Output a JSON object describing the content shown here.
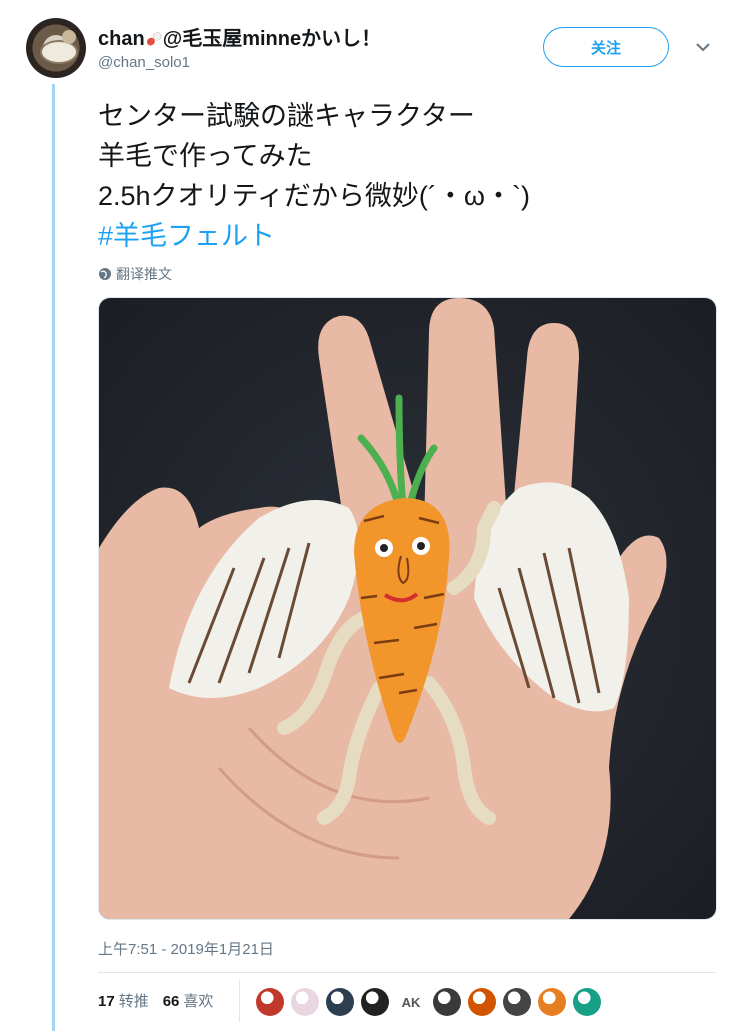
{
  "author": {
    "display_name": "chan",
    "display_name_suffix": "@毛玉屋minneかいし！",
    "handle": "@chan_solo1"
  },
  "follow_button": {
    "label": "关注"
  },
  "tweet": {
    "lines": [
      "センター試験の謎キャラクター",
      "羊毛で作ってみた",
      "2.5hクオリティだから微妙(´・ω・`)"
    ],
    "hashtag": "#羊毛フェルト",
    "translate_label": "翻译推文",
    "timestamp": "上午7:51 - 2019年1月21日"
  },
  "stats": {
    "retweets_count": "17",
    "retweets_label": "转推",
    "likes_count": "66",
    "likes_label": "喜欢"
  },
  "likers": [
    {
      "kind": "avatar",
      "color": "#c0392b"
    },
    {
      "kind": "avatar",
      "color": "#e8d7e0"
    },
    {
      "kind": "avatar",
      "color": "#2c3e50"
    },
    {
      "kind": "avatar",
      "color": "#222222"
    },
    {
      "kind": "text",
      "text": "AK"
    },
    {
      "kind": "avatar",
      "color": "#3a3a3a"
    },
    {
      "kind": "avatar",
      "color": "#d35400"
    },
    {
      "kind": "avatar",
      "color": "#444444"
    },
    {
      "kind": "avatar",
      "color": "#e67e22"
    },
    {
      "kind": "avatar",
      "color": "#16a085"
    }
  ],
  "colors": {
    "accent": "#1da1f2",
    "thread_line": "#a3d4f2",
    "secondary_text": "#657786"
  }
}
